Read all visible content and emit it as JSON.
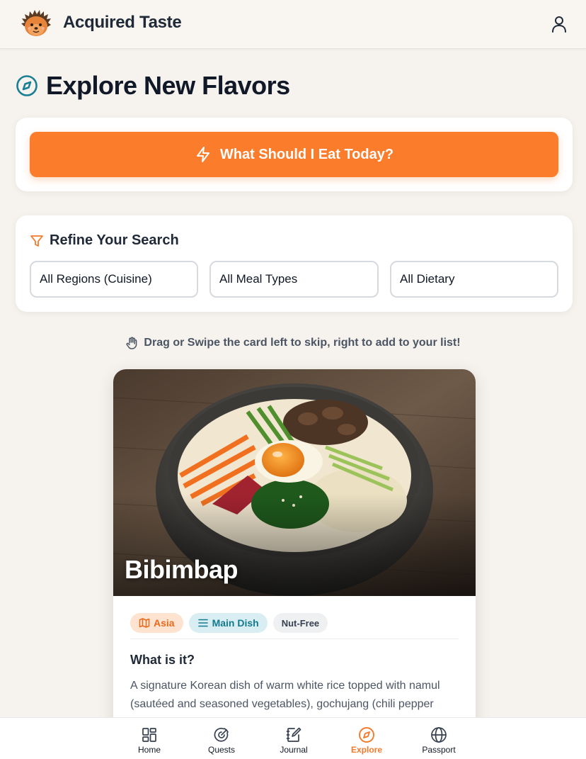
{
  "header": {
    "app_title": "Acquired Taste",
    "logo_icon": "hedgehog-logo-icon",
    "profile_icon": "user-icon"
  },
  "page": {
    "title": "Explore New Flavors",
    "title_icon": "compass-icon"
  },
  "random": {
    "button_label": "What Should I Eat Today?",
    "icon": "lightning-icon"
  },
  "filters": {
    "title": "Refine Your Search",
    "icon": "filter-icon",
    "region": "All Regions (Cuisine)",
    "meal_type": "All Meal Types",
    "dietary": "All Dietary"
  },
  "hint": {
    "text": "Drag or Swipe the card left to skip, right to add to your list!",
    "icon": "hand-icon"
  },
  "dish": {
    "name": "Bibimbap",
    "tags": {
      "region": "Asia",
      "meal": "Main Dish",
      "dietary": "Nut-Free"
    },
    "description_heading": "What is it?",
    "description": "A signature Korean dish of warm white rice topped with namul (sautéed and seasoned vegetables), gochujang (chili pepper"
  },
  "nav": {
    "items": [
      {
        "label": "Home",
        "icon": "grid-icon"
      },
      {
        "label": "Quests",
        "icon": "target-icon"
      },
      {
        "label": "Journal",
        "icon": "notebook-icon"
      },
      {
        "label": "Explore",
        "icon": "compass-icon"
      },
      {
        "label": "Passport",
        "icon": "globe-icon"
      }
    ],
    "active": "Explore"
  },
  "colors": {
    "accent": "#fb7c2b",
    "teal": "#147a8f",
    "background": "#f6f2ed"
  }
}
